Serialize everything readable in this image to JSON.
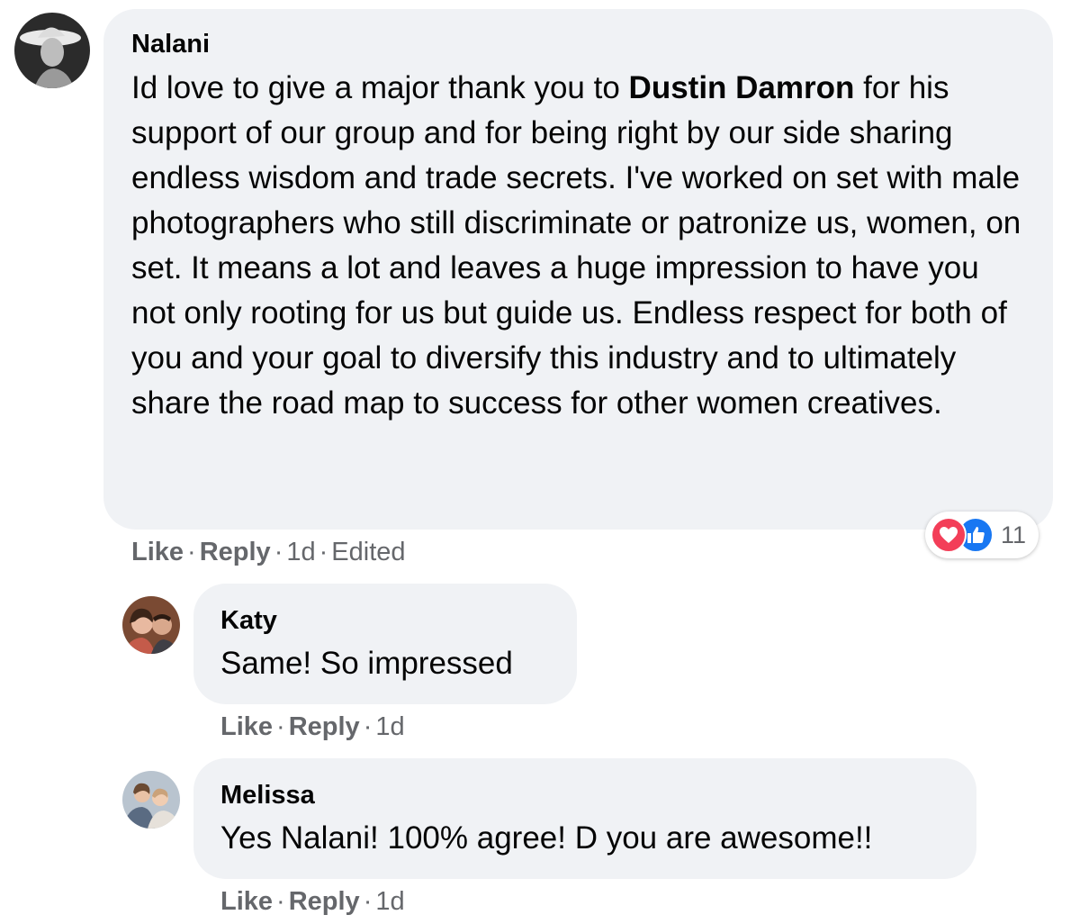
{
  "comments": [
    {
      "author": "Nalani",
      "text_before": "Id love to give a major thank you to ",
      "mention": "Dustin Damron",
      "text_after": " for his support of our group and for being right by our side sharing endless wisdom and trade secrets. I've worked on set with male photographers who still discriminate or patronize us, women, on set. It means a lot and leaves a huge impression to have you not only rooting for us but guide us. Endless respect for both of you and your goal to diversify this industry and to ultimately share the road map to success for other women creatives.",
      "actions": {
        "like": "Like",
        "reply": "Reply",
        "time": "1d",
        "edited": "Edited",
        "separator": "·"
      },
      "reactions": {
        "icons": [
          "love-icon",
          "like-icon"
        ],
        "count": "11",
        "colors": {
          "love": "#f33e58",
          "like": "#1877f2"
        }
      }
    },
    {
      "author": "Katy",
      "text": "Same! So impressed",
      "actions": {
        "like": "Like",
        "reply": "Reply",
        "time": "1d",
        "separator": "·"
      }
    },
    {
      "author": "Melissa",
      "text": "Yes Nalani! 100% agree! D you are awesome!!",
      "actions": {
        "like": "Like",
        "reply": "Reply",
        "time": "1d",
        "separator": "·"
      }
    }
  ],
  "theme": {
    "bubble_bg": "#f0f2f5",
    "secondary_text": "#65676b",
    "primary_text": "#050505"
  }
}
